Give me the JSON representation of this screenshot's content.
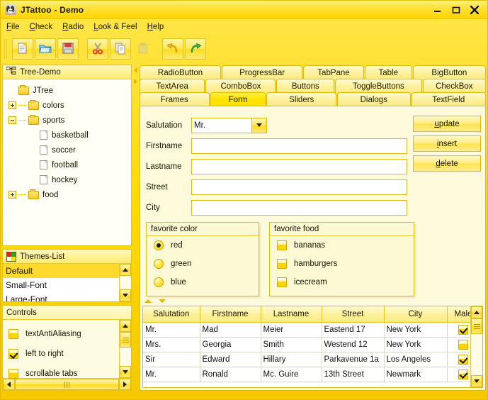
{
  "window": {
    "title": "JTattoo - Demo",
    "icon": "panda-icon",
    "buttons": [
      {
        "name": "minimize-button",
        "glyph": "minimize"
      },
      {
        "name": "maximize-button",
        "glyph": "maximize"
      },
      {
        "name": "close-button",
        "glyph": "close"
      }
    ]
  },
  "menubar": {
    "items": [
      {
        "label": "File",
        "mnemonic": "F",
        "rest": "ile"
      },
      {
        "label": "Check",
        "mnemonic": "C",
        "rest": "heck"
      },
      {
        "label": "Radio",
        "mnemonic": "R",
        "rest": "adio"
      },
      {
        "label": "Look & Feel",
        "mnemonic": "L",
        "rest": "ook & Feel"
      },
      {
        "label": "Help",
        "mnemonic": "H",
        "rest": "elp"
      }
    ]
  },
  "toolbar": {
    "buttons": [
      {
        "name": "new-icon",
        "label": "New",
        "enabled": true
      },
      {
        "name": "open-folder-icon",
        "label": "Open",
        "enabled": true
      },
      {
        "name": "save-floppy-icon",
        "label": "Save",
        "enabled": true
      },
      {
        "name": "cut-scissors-icon",
        "label": "Cut",
        "enabled": true
      },
      {
        "name": "copy-icon",
        "label": "Copy",
        "enabled": true
      },
      {
        "name": "paste-clipboard-icon",
        "label": "Paste",
        "enabled": false
      },
      {
        "name": "undo-arrow-icon",
        "label": "Undo",
        "enabled": true
      },
      {
        "name": "redo-arrow-icon",
        "label": "Redo",
        "enabled": true
      }
    ]
  },
  "tree_panel": {
    "title": "Tree-Demo",
    "icon": "tree-structure-icon",
    "nodes": [
      {
        "label": "JTree",
        "type": "folder",
        "depth": 0,
        "handle": "none"
      },
      {
        "label": "colors",
        "type": "folder",
        "depth": 1,
        "handle": "plus"
      },
      {
        "label": "sports",
        "type": "folder",
        "depth": 1,
        "handle": "minus"
      },
      {
        "label": "basketball",
        "type": "doc",
        "depth": 2,
        "handle": "none"
      },
      {
        "label": "soccer",
        "type": "doc",
        "depth": 2,
        "handle": "none"
      },
      {
        "label": "football",
        "type": "doc",
        "depth": 2,
        "handle": "none"
      },
      {
        "label": "hockey",
        "type": "doc",
        "depth": 2,
        "handle": "none"
      },
      {
        "label": "food",
        "type": "folder",
        "depth": 1,
        "handle": "plus"
      }
    ]
  },
  "themes_panel": {
    "title": "Themes-List",
    "icon": "color-swatch-icon",
    "items": [
      {
        "label": "Default",
        "selected": true
      },
      {
        "label": "Small-Font",
        "selected": false
      },
      {
        "label": "Large-Font",
        "selected": false
      }
    ]
  },
  "controls_panel": {
    "title": "Controls",
    "items": [
      {
        "label": "textAntiAliasing",
        "checked": false
      },
      {
        "label": "left to right",
        "checked": true
      },
      {
        "label": "scrollable tabs",
        "checked": false
      }
    ]
  },
  "tabs": {
    "rows": [
      [
        {
          "label": "RadioButton",
          "selected": false,
          "flex": 115
        },
        {
          "label": "ProgressBar",
          "selected": false,
          "flex": 114
        },
        {
          "label": "TabPane",
          "selected": false,
          "flex": 85
        },
        {
          "label": "Table",
          "selected": false,
          "flex": 66
        },
        {
          "label": "BigButton",
          "selected": false,
          "flex": 103
        }
      ],
      [
        {
          "label": "TextArea",
          "selected": false,
          "flex": 93
        },
        {
          "label": "ComboBox",
          "selected": false,
          "flex": 100
        },
        {
          "label": "Buttons",
          "selected": false,
          "flex": 82
        },
        {
          "label": "ToggleButtons",
          "selected": false,
          "flex": 124
        },
        {
          "label": "CheckBox",
          "selected": false,
          "flex": 90
        }
      ],
      [
        {
          "label": "Frames",
          "selected": false,
          "flex": 98
        },
        {
          "label": "Form",
          "selected": true,
          "flex": 78
        },
        {
          "label": "Sliders",
          "selected": false,
          "flex": 98
        },
        {
          "label": "Dialogs",
          "selected": false,
          "flex": 103
        },
        {
          "label": "TextField",
          "selected": false,
          "flex": 105
        }
      ]
    ]
  },
  "form": {
    "fields": [
      {
        "label": "Salutation",
        "type": "combo",
        "value": "Mr.",
        "placeholder": ""
      },
      {
        "label": "Firstname",
        "type": "text",
        "value": "",
        "placeholder": ""
      },
      {
        "label": "Lastname",
        "type": "text",
        "value": "",
        "placeholder": ""
      },
      {
        "label": "Street",
        "type": "text",
        "value": "",
        "placeholder": ""
      },
      {
        "label": "City",
        "type": "text",
        "value": "",
        "placeholder": ""
      }
    ],
    "buttons": [
      {
        "name": "update-button",
        "mnemonic": "u",
        "rest": "pdate"
      },
      {
        "name": "insert-button",
        "mnemonic": "i",
        "rest": "nsert"
      },
      {
        "name": "delete-button",
        "mnemonic": "d",
        "rest": "elete"
      }
    ]
  },
  "groups": [
    {
      "name": "favorite-color-group",
      "title": "favorite color",
      "kind": "radio",
      "options": [
        {
          "label": "red",
          "selected": true
        },
        {
          "label": "green",
          "selected": false
        },
        {
          "label": "blue",
          "selected": false
        }
      ]
    },
    {
      "name": "favorite-food-group",
      "title": "favorite food",
      "kind": "checkbox",
      "options": [
        {
          "label": "bananas",
          "selected": false
        },
        {
          "label": "hamburgers",
          "selected": false
        },
        {
          "label": "icecream",
          "selected": false
        }
      ]
    }
  ],
  "table": {
    "columns": [
      "Salutation",
      "Firstname",
      "Lastname",
      "Street",
      "City",
      "Male"
    ],
    "rows": [
      {
        "cells": [
          "Mr.",
          "Mad",
          "Meier",
          "Eastend 17",
          "New York"
        ],
        "male": true
      },
      {
        "cells": [
          "Mrs.",
          "Georgia",
          "Smith",
          "Westend 12",
          "New York"
        ],
        "male": false
      },
      {
        "cells": [
          "Sir",
          "Edward",
          "Hillary",
          "Parkavenue 1a",
          "Los Angeles"
        ],
        "male": true
      },
      {
        "cells": [
          "Mr.",
          "Ronald",
          "Mc. Guire",
          "13th Street",
          "Newmark"
        ],
        "male": true
      }
    ]
  },
  "colors": {
    "accent": "#ffd900",
    "tab_selected": "#ffe400",
    "list_selection": "#ffd92e",
    "border": "#ddbb14",
    "panel_bg": "#fdfbdc",
    "text": "#141400"
  }
}
